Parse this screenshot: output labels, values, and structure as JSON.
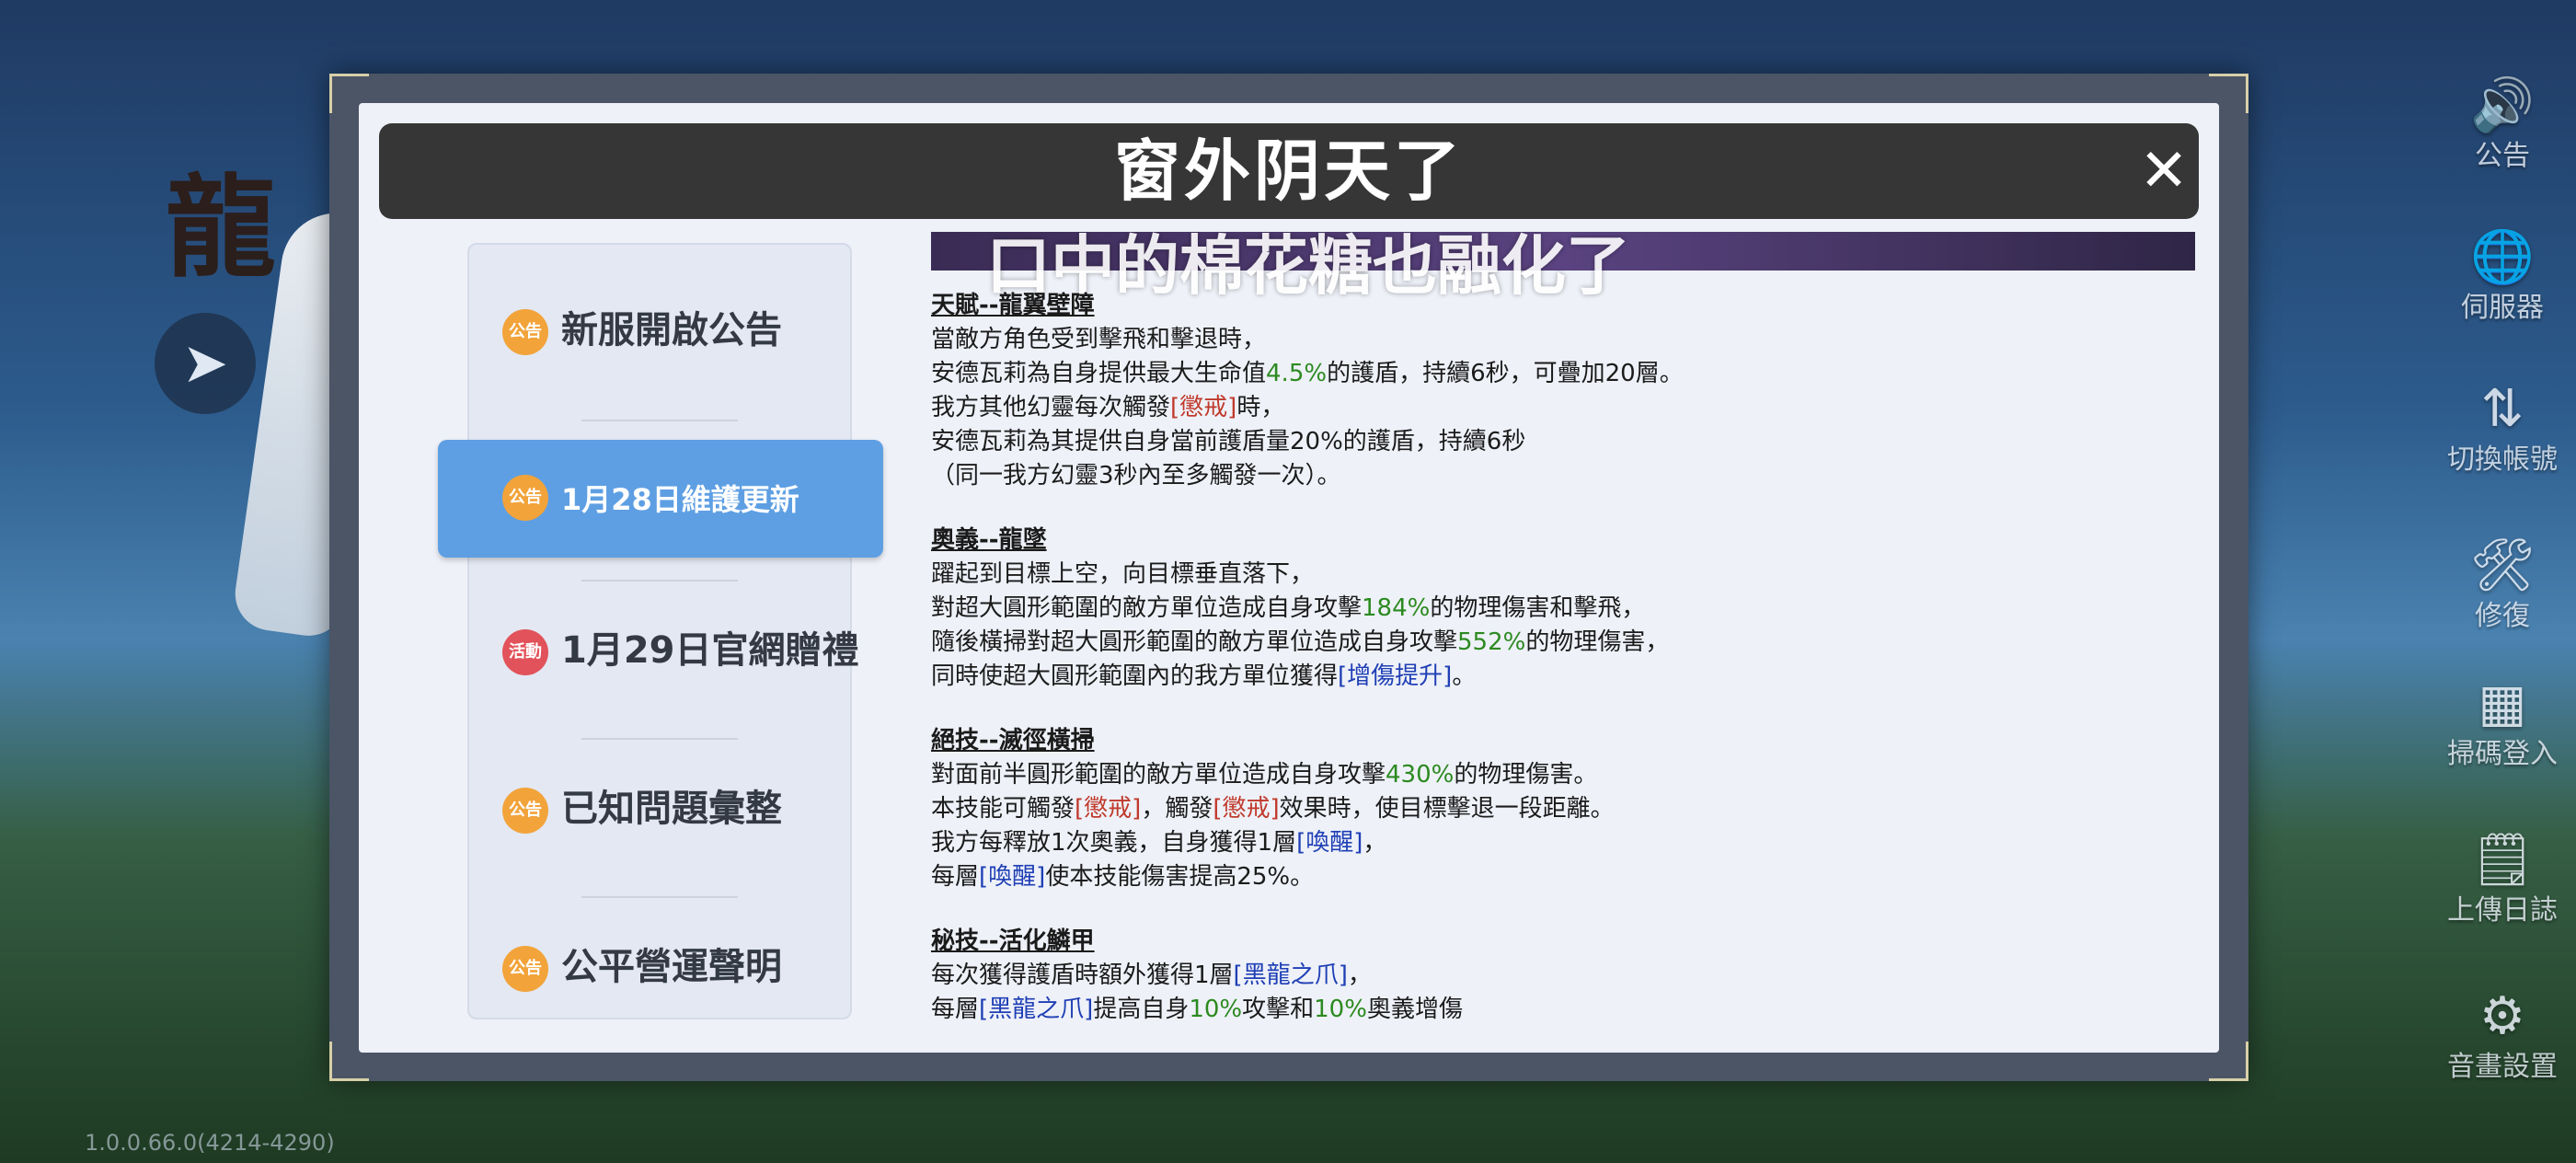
{
  "overlay": {
    "title": "窗外阴天了",
    "subtitle": "口中的棉花糖也融化了"
  },
  "side_menu": [
    {
      "icon": "speaker-icon",
      "glyph": "🔊",
      "label": "公告"
    },
    {
      "icon": "globe-icon",
      "glyph": "🌐",
      "label": "伺服器"
    },
    {
      "icon": "switch-account-icon",
      "glyph": "⇅",
      "label": "切換帳號"
    },
    {
      "icon": "repair-icon",
      "glyph": "🛠",
      "label": "修復"
    },
    {
      "icon": "scan-icon",
      "glyph": "▦",
      "label": "掃碼登入"
    },
    {
      "icon": "upload-log-icon",
      "glyph": "🗒",
      "label": "上傳日誌"
    },
    {
      "icon": "gear-icon",
      "glyph": "⚙",
      "label": "音畫設置"
    }
  ],
  "version": "1.0.0.66.0(4214-4290)",
  "close_glyph": "✕",
  "nav": [
    {
      "badge": "公告",
      "label": "新服開啟公告",
      "active": false
    },
    {
      "badge": "公告",
      "label": "1月28日維護更新",
      "active": true
    },
    {
      "badge": "活動",
      "label": "1月29日官網贈禮",
      "active": false
    },
    {
      "badge": "公告",
      "label": "已知問題彙整",
      "active": false
    },
    {
      "badge": "公告",
      "label": "公平營運聲明",
      "active": false
    }
  ],
  "content": {
    "s1_title": "天賦--龍翼壁障",
    "s1_l1": "當敵方角色受到擊飛和擊退時，",
    "s1_l2a": "安德瓦莉為自身提供最大生命值",
    "s1_l2v": "4.5%",
    "s1_l2b": "的護盾，持續6秒，可疊加20層。",
    "s1_l3a": "我方其他幻靈每次觸發",
    "s1_l3v": "[懲戒]",
    "s1_l3b": "時，",
    "s1_l4": "安德瓦莉為其提供自身當前護盾量20%的護盾，持續6秒",
    "s1_l5": "（同一我方幻靈3秒內至多觸發一次）。",
    "s2_title": "奧義--龍墜",
    "s2_l1": "躍起到目標上空，向目標垂直落下，",
    "s2_l2a": "對超大圓形範圍的敵方單位造成自身攻擊",
    "s2_l2v": "184%",
    "s2_l2b": "的物理傷害和擊飛，",
    "s2_l3a": "隨後橫掃對超大圓形範圍的敵方單位造成自身攻擊",
    "s2_l3v": "552%",
    "s2_l3b": "的物理傷害，",
    "s2_l4a": "同時使超大圓形範圍內的我方單位獲得",
    "s2_l4v": "[增傷提升]",
    "s2_l4b": "。",
    "s3_title": "絕技--滅徑橫掃",
    "s3_l1a": "對面前半圓形範圍的敵方單位造成自身攻擊",
    "s3_l1v": "430%",
    "s3_l1b": "的物理傷害。",
    "s3_l2a": "本技能可觸發",
    "s3_l2v1": "[懲戒]",
    "s3_l2m": "，觸發",
    "s3_l2v2": "[懲戒]",
    "s3_l2b": "效果時，使目標擊退一段距離。",
    "s3_l3a": "我方每釋放1次奧義，自身獲得1層",
    "s3_l3v": "[喚醒]",
    "s3_l3b": "，",
    "s3_l4a": "每層",
    "s3_l4v": "[喚醒]",
    "s3_l4b": "使本技能傷害提高25%。",
    "s4_title": "秘技--活化鱗甲",
    "s4_l1a": "每次獲得護盾時額外獲得1層",
    "s4_l1v": "[黑龍之爪]",
    "s4_l1b": "，",
    "s4_l2a": "每層",
    "s4_l2v": "[黑龍之爪]",
    "s4_l2b": "提高自身",
    "s4_l2v2": "10%",
    "s4_l2c": "攻擊和",
    "s4_l2v3": "10%",
    "s4_l2d": "奧義增傷"
  }
}
